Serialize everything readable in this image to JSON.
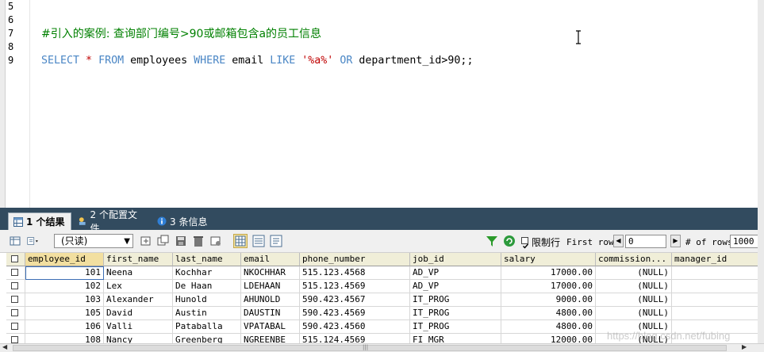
{
  "editor": {
    "line_numbers": [
      "5",
      "6",
      "7",
      "8",
      "9"
    ],
    "comment_line": "#引入的案例: 查询部门编号>90或邮箱包含a的员工信息",
    "sql": {
      "kw_select": "SELECT",
      "star": " * ",
      "kw_from": "FROM",
      "table": " employees ",
      "kw_where": "WHERE",
      "col_email": " email ",
      "kw_like": "LIKE",
      "pattern": " '%a%' ",
      "kw_or": "OR",
      "cond": " department_id>90;;"
    }
  },
  "result_tabs": [
    {
      "label": "1 个结果",
      "icon": "table-icon"
    },
    {
      "label": "2 个配置文件",
      "icon": "profile-icon"
    },
    {
      "label": "3 条信息",
      "icon": "info-icon"
    }
  ],
  "toolbar": {
    "mode_select": "(只读)",
    "limit_label": "限制行",
    "first_row_label": "First row",
    "first_row_value": "0",
    "rows_label": "# of rows",
    "rows_value": "1000"
  },
  "grid": {
    "columns": [
      "employee_id",
      "first_name",
      "last_name",
      "email",
      "phone_number",
      "job_id",
      "salary",
      "commission...",
      "manager_id"
    ],
    "rows": [
      [
        "101",
        "Neena",
        "Kochhar",
        "NKOCHHAR",
        "515.123.4568",
        "AD_VP",
        "17000.00",
        "(NULL)",
        ""
      ],
      [
        "102",
        "Lex",
        "De Haan",
        "LDEHAAN",
        "515.123.4569",
        "AD_VP",
        "17000.00",
        "(NULL)",
        ""
      ],
      [
        "103",
        "Alexander",
        "Hunold",
        "AHUNOLD",
        "590.423.4567",
        "IT_PROG",
        "9000.00",
        "(NULL)",
        ""
      ],
      [
        "105",
        "David",
        "Austin",
        "DAUSTIN",
        "590.423.4569",
        "IT_PROG",
        "4800.00",
        "(NULL)",
        ""
      ],
      [
        "106",
        "Valli",
        "Pataballa",
        "VPATABAL",
        "590.423.4560",
        "IT_PROG",
        "4800.00",
        "(NULL)",
        ""
      ],
      [
        "108",
        "Nancy",
        "Greenberg",
        "NGREENBE",
        "515.124.4569",
        "FI_MGR",
        "12000.00",
        "(NULL)",
        ""
      ]
    ]
  },
  "watermark": "https://blog.csdn.net/fubing"
}
